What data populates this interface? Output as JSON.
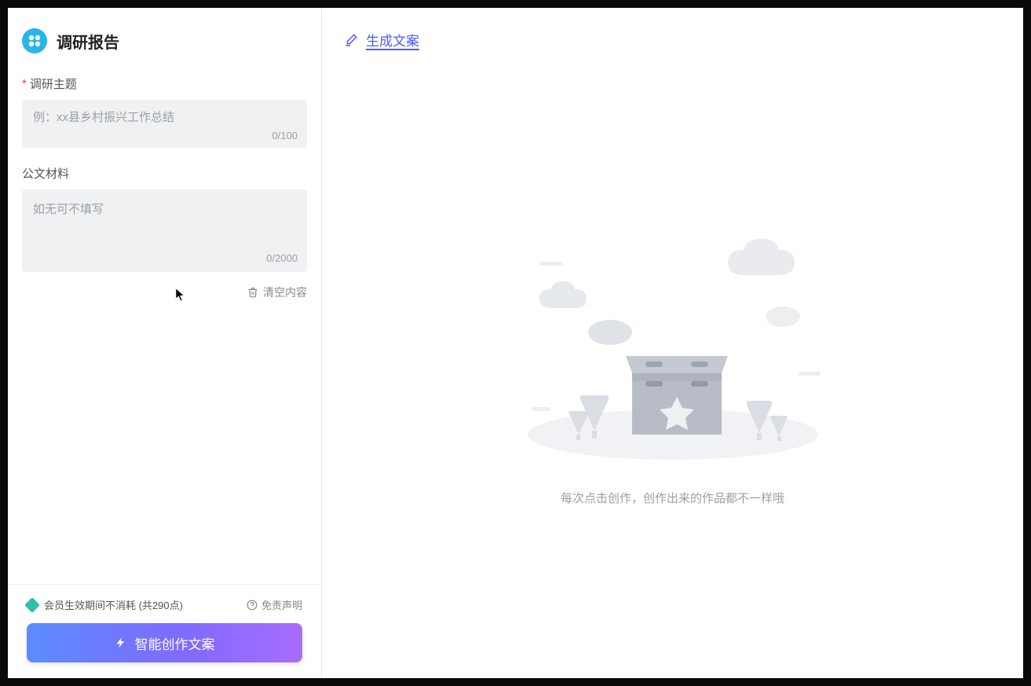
{
  "leftPanel": {
    "title": "调研报告",
    "topic": {
      "label": "调研主题",
      "placeholder": "例：xx县乡村振兴工作总结",
      "counter": "0/100"
    },
    "material": {
      "label": "公文材料",
      "placeholder": "如无可不填写",
      "counter": "0/2000"
    },
    "clear": "清空内容",
    "footer": {
      "points": "会员生效期间不消耗 (共290点)",
      "disclaimer": "免责声明",
      "button": "智能创作文案"
    }
  },
  "rightPanel": {
    "title": "生成文案",
    "emptyText": "每次点击创作，创作出来的作品都不一样哦"
  }
}
